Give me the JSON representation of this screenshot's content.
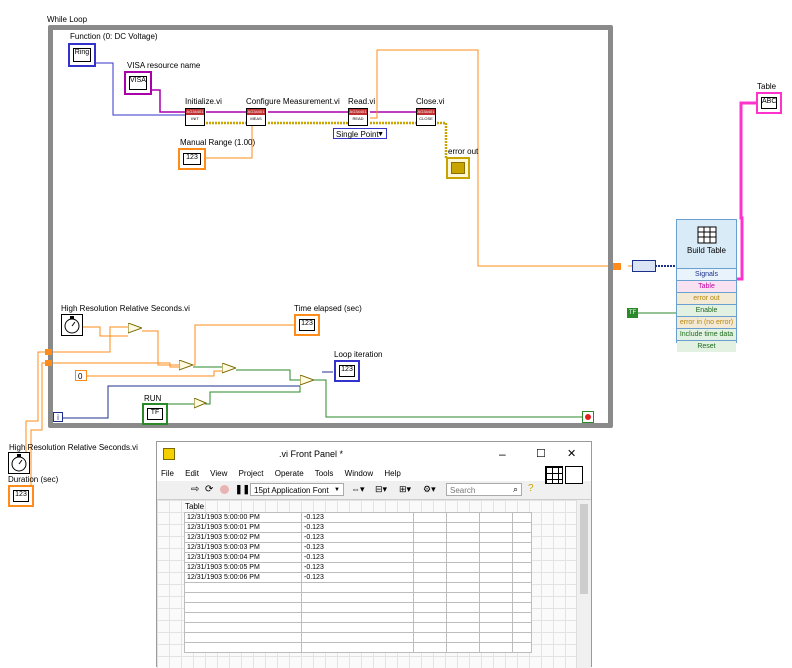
{
  "diagram": {
    "while_loop_label": "While Loop",
    "function_label": "Function (0: DC Voltage)",
    "visa_label": "VISA resource name",
    "initialize_label": "Initialize.vi",
    "configure_label": "Configure Measurement.vi",
    "read_label": "Read.vi",
    "close_label": "Close.vi",
    "manual_range_label": "Manual Range (1.00)",
    "single_point_label": "Single Point",
    "error_out_label": "error out",
    "hr_seconds_inner_label": "High Resolution Relative Seconds.vi",
    "time_elapsed_label": "Time elapsed (sec)",
    "loop_iteration_label": "Loop iteration",
    "run_label": "RUN",
    "zero_const": "0",
    "iteration_terminal": "i",
    "hr_seconds_outer_label": "High Resolution Relative Seconds.vi",
    "duration_label": "Duration (sec)",
    "table_label": "Table",
    "tf_const": "TF",
    "enum_text": "Ring",
    "num_text": "123",
    "visa_text": "VISA",
    "table_icon_text": "ABC"
  },
  "build_table": {
    "title": "Build Table",
    "rows": [
      "Signals",
      "Table",
      "error out",
      "Enable",
      "error in (no error)",
      "Include time data",
      "Reset"
    ]
  },
  "front_panel": {
    "title": ".vi Front Panel *",
    "menu": [
      "File",
      "Edit",
      "View",
      "Project",
      "Operate",
      "Tools",
      "Window",
      "Help"
    ],
    "font_select": "15pt Application Font",
    "search_placeholder": "Search",
    "table_caption": "Table",
    "rows": [
      {
        "time": "12/31/1903 5:00:00 PM",
        "value": "-0.123"
      },
      {
        "time": "12/31/1903 5:00:01 PM",
        "value": "-0.123"
      },
      {
        "time": "12/31/1903 5:00:02 PM",
        "value": "-0.123"
      },
      {
        "time": "12/31/1903 5:00:03 PM",
        "value": "-0.123"
      },
      {
        "time": "12/31/1903 5:00:04 PM",
        "value": "-0.123"
      },
      {
        "time": "12/31/1903 5:00:05 PM",
        "value": "-0.123"
      },
      {
        "time": "12/31/1903 5:00:06 PM",
        "value": "-0.123"
      }
    ]
  },
  "colors": {
    "loop_border": "#8a8a8a",
    "error_wire": "#c8a400",
    "numeric_wire": "#ff8c1a",
    "enum_wire": "#3333cc",
    "visa_wire": "#aa00aa",
    "table_wire": "#ff33cc",
    "bool_wire": "#2a8a2a"
  }
}
